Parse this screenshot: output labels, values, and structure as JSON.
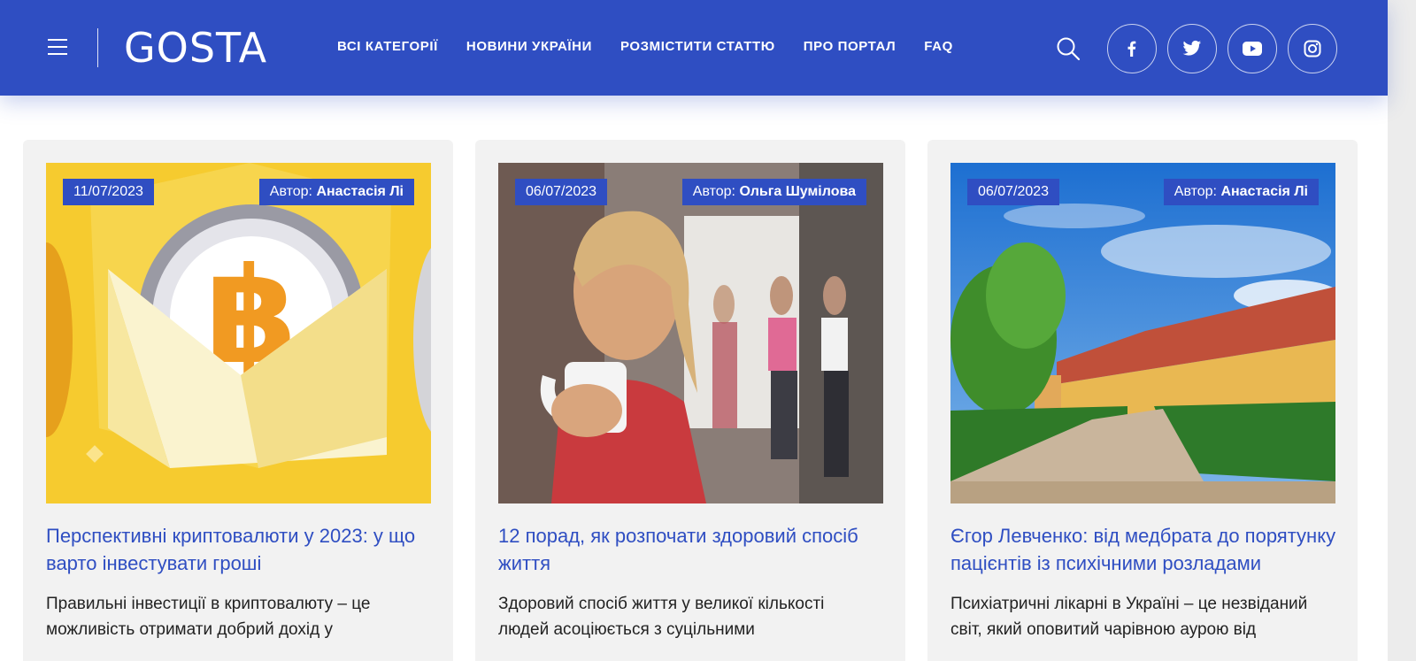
{
  "header": {
    "logo": "GOSTA",
    "nav": [
      "ВСІ КАТЕГОРІЇ",
      "НОВИНИ УКРАЇНИ",
      "РОЗМІСТИТИ СТАТТЮ",
      "ПРО ПОРТАЛ",
      "FAQ"
    ],
    "icons": [
      "menu-icon",
      "search-icon",
      "facebook-icon",
      "twitter-icon",
      "youtube-icon",
      "instagram-icon"
    ]
  },
  "colors": {
    "brand": "#2f4ec2",
    "card_bg": "#f2f2f2",
    "text": "#222222"
  },
  "author_label": "Автор:",
  "cards": [
    {
      "date": "11/07/2023",
      "author": "Анастасія Лі",
      "title": "Перспективні криптовалюти у 2023: у що варто інвестувати гроші",
      "excerpt": "Правильні інвестиції в криптовалюту – це можливість отримати добрий дохід у"
    },
    {
      "date": "06/07/2023",
      "author": "Ольга Шумілова",
      "title": "12 порад, як розпочати здоровий спосіб життя",
      "excerpt": "Здоровий спосіб життя у великої кількості людей асоціюється з суцільними"
    },
    {
      "date": "06/07/2023",
      "author": "Анастасія Лі",
      "title": "Єгор Левченко: від медбрата до порятунку пацієнтів із психічними розладами",
      "excerpt": "Психіатричні лікарні в Україні – це незвіданий світ, який оповитий чарівною аурою від"
    }
  ]
}
